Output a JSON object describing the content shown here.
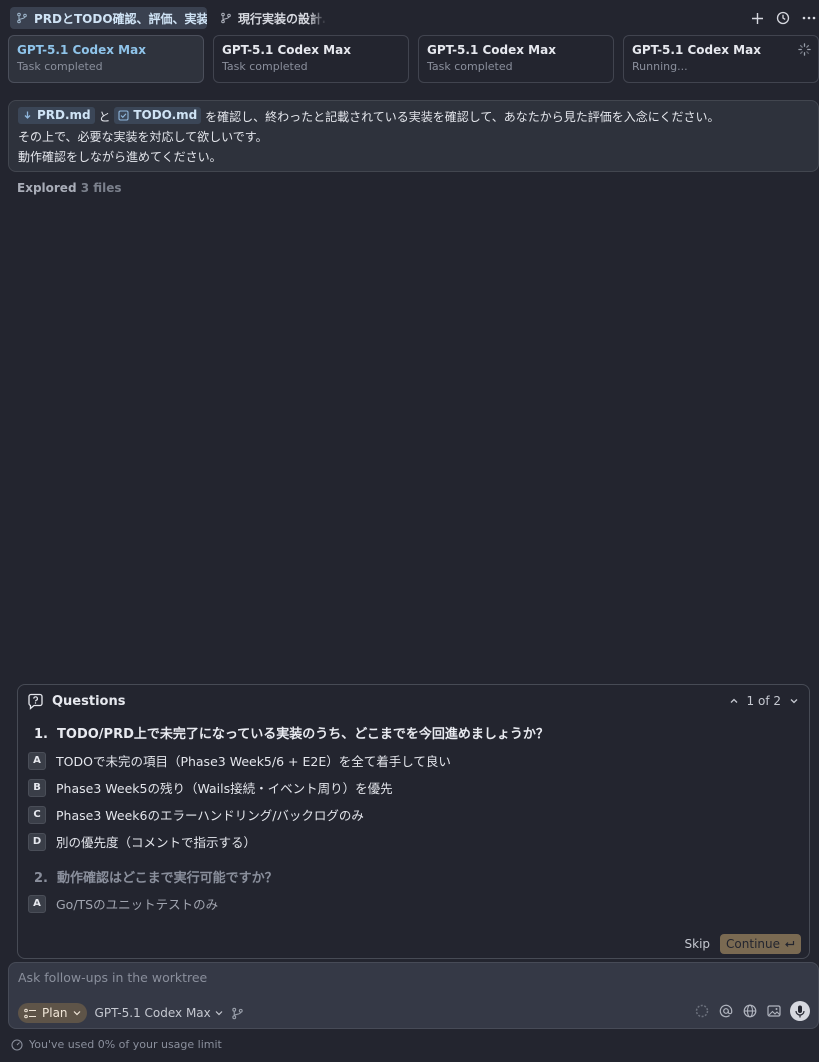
{
  "tabs": [
    {
      "label": "PRDとTODO確認、評価、実装",
      "active": true
    },
    {
      "label": "現行実装の設計…",
      "active": false
    }
  ],
  "cards": [
    {
      "name": "GPT-5.1 Codex Max",
      "status": "Task completed",
      "active": true
    },
    {
      "name": "GPT-5.1 Codex Max",
      "status": "Task completed",
      "active": false
    },
    {
      "name": "GPT-5.1 Codex Max",
      "status": "Task completed",
      "active": false
    },
    {
      "name": "GPT-5.1 Codex Max",
      "status": "Running...",
      "active": false,
      "icon": "spinner-icon"
    }
  ],
  "prompt": {
    "chip1": "PRD.md",
    "connector": "と",
    "chip2": "TODO.md",
    "line1_rest": "を確認し、終わったと記載されている実装を確認して、あなたから見た評価を入念にください。",
    "line2": "その上で、必要な実装を対応して欲しいです。",
    "line3": "動作確認をしながら進めてください。"
  },
  "explored": {
    "label": "Explored",
    "count": "3 files"
  },
  "questions": {
    "title": "Questions",
    "pager": "1 of 2",
    "items": [
      {
        "title": "1.  TODO/PRD上で未完了になっている実装のうち、どこまでを今回進めましょうか？",
        "options": [
          {
            "key": "A",
            "text": "TODOで未完の項目（Phase3 Week5/6 + E2E）を全て着手して良い"
          },
          {
            "key": "B",
            "text": "Phase3 Week5の残り（Wails接続・イベント周り）を優先"
          },
          {
            "key": "C",
            "text": "Phase3 Week6のエラーハンドリング/バックログのみ"
          },
          {
            "key": "D",
            "text": "別の優先度（コメントで指示する）"
          }
        ]
      },
      {
        "title": "2.  動作確認はどこまで実行可能ですか？",
        "options": [
          {
            "key": "A",
            "text": "Go/TSのユニットテストのみ"
          }
        ]
      }
    ],
    "skip_label": "Skip",
    "continue_label": "Continue"
  },
  "composer": {
    "placeholder": "Ask follow-ups in the worktree",
    "plan_label": "Plan",
    "model_label": "GPT-5.1 Codex Max"
  },
  "usage": "You've used 0% of your usage limit",
  "colors": {
    "background": "#23252f",
    "accent": "#8fc4ea",
    "continue": "#7a6a52",
    "plan": "#5e5448"
  }
}
